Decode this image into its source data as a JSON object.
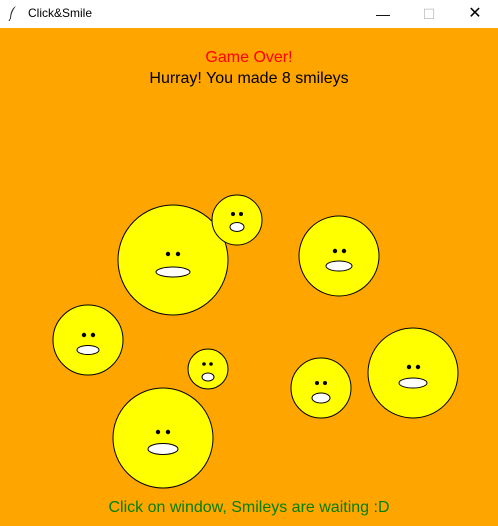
{
  "window": {
    "title": "Click&Smile",
    "minimize_glyph": "—",
    "maximize_glyph": "☐",
    "close_glyph": "✕"
  },
  "game": {
    "status_text": "Game Over!",
    "score_text": "Hurray! You made 8 smileys",
    "footer_text": "Click on window, Smileys are waiting :D"
  },
  "colors": {
    "background": "#ffa500",
    "smiley_face": "#ffff00",
    "status": "#ff0000",
    "footer": "#008000"
  },
  "smiley_count": 8
}
